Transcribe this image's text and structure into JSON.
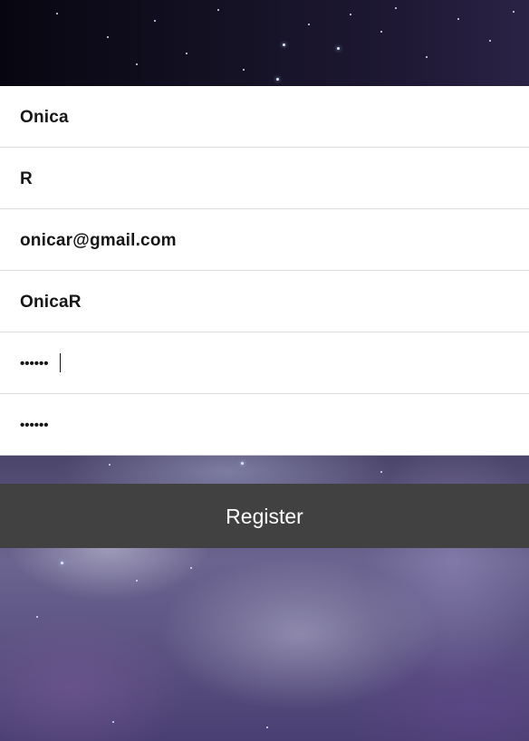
{
  "form": {
    "first_name": "Onica",
    "last_name": "R",
    "email": "onicar@gmail.com",
    "username": "OnicaR",
    "password": "••••••",
    "confirm_password": "••••••"
  },
  "register_button": {
    "label": "Register"
  },
  "colors": {
    "button_background": "#414141",
    "button_text": "#ffffff",
    "field_background": "#ffffff",
    "field_text": "#161616"
  }
}
